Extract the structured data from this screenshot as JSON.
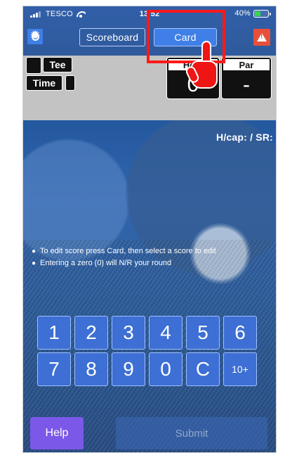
{
  "status_bar": {
    "carrier": "TESCO",
    "time": "13 52",
    "battery": "40%"
  },
  "toolbar": {
    "scoreboard_label": "Scoreboard",
    "card_label": "Card"
  },
  "scoreboard": {
    "tee_label": "Tee",
    "time_label": "Time",
    "hole_label": "Hole",
    "hole_value": "0",
    "par_label": "Par",
    "par_value": "-"
  },
  "handicap": {
    "label": "H/cap: / SR:"
  },
  "instructions": [
    "To edit score press Card, then select a score to edit",
    "Entering a zero (0) will N/R your round"
  ],
  "keypad": {
    "keys": [
      "1",
      "2",
      "3",
      "4",
      "5",
      "6",
      "7",
      "8",
      "9",
      "0",
      "C",
      "10+"
    ]
  },
  "footer": {
    "help_label": "Help",
    "submit_label": "Submit"
  },
  "colors": {
    "accent_blue": "#3f7fe7",
    "alert_red": "#e84f3b",
    "highlight_red": "#ff1a1a",
    "help_purple": "#7c58e8"
  },
  "icons": {
    "settings": "gear-icon",
    "alert": "warning-icon",
    "pointer": "hand-pointer-icon"
  }
}
